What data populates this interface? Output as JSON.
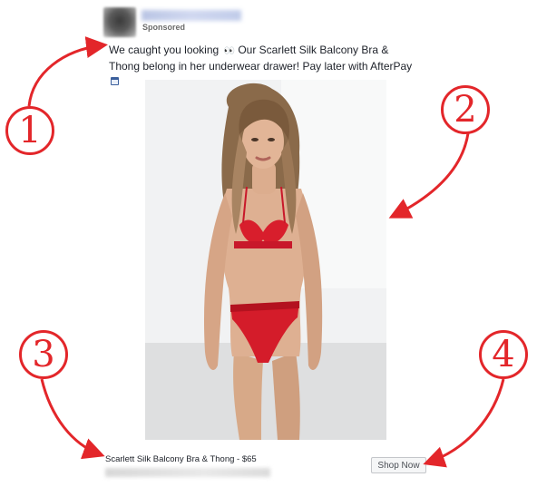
{
  "post": {
    "sponsored_label": "Sponsored",
    "text_before": "We caught you looking",
    "eyes_emoji": "👀",
    "text_after": "Our Scarlett Silk Balcony Bra & Thong belong in her underwear drawer! Pay later with AfterPay",
    "calendar_icon": "calendar-icon"
  },
  "link": {
    "headline": "Scarlett Silk Balcony Bra & Thong - $65",
    "cta_label": "Shop Now"
  },
  "annotations": {
    "color": "#e3262a",
    "callouts": [
      "1",
      "2",
      "3",
      "4"
    ]
  }
}
